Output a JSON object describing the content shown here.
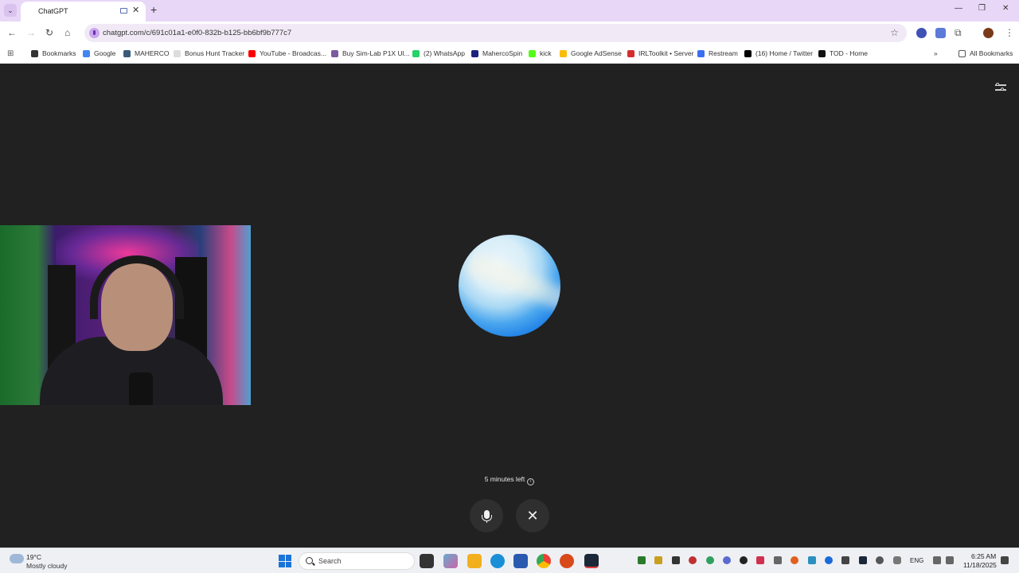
{
  "browser": {
    "tab": {
      "title": "ChatGPT"
    },
    "url": "chatgpt.com/c/691c01a1-e0f0-832b-b125-bb6bf9b777c7",
    "bookmarks": [
      {
        "label": "Bookmarks",
        "icon": "star-icon",
        "color": "#333333"
      },
      {
        "label": "Google",
        "icon": "google-icon",
        "color": "#4285f4"
      },
      {
        "label": "MAHERCO",
        "icon": "maherco-icon",
        "color": "#3a5a7a"
      },
      {
        "label": "Bonus Hunt Tracker",
        "icon": "page-icon",
        "color": "#dddddd"
      },
      {
        "label": "YouTube - Broadcas...",
        "icon": "youtube-icon",
        "color": "#ff0000"
      },
      {
        "label": "Buy Sim-Lab P1X Ul...",
        "icon": "simlab-icon",
        "color": "#7a5aa0"
      },
      {
        "label": "(2) WhatsApp",
        "icon": "whatsapp-icon",
        "color": "#25d366"
      },
      {
        "label": "MahercoSpin",
        "icon": "mahercospin-icon",
        "color": "#1a237e"
      },
      {
        "label": "kick",
        "icon": "kick-icon",
        "color": "#53fc18"
      },
      {
        "label": "Google AdSense",
        "icon": "adsense-icon",
        "color": "#fbbc04"
      },
      {
        "label": "IRLToolkit • Server",
        "icon": "irltoolkit-icon",
        "color": "#d32f2f"
      },
      {
        "label": "Restream",
        "icon": "restream-icon",
        "color": "#3a6ff0"
      },
      {
        "label": "(16) Home / Twitter",
        "icon": "x-icon",
        "color": "#000000"
      },
      {
        "label": "TOD - Home",
        "icon": "tod-icon",
        "color": "#111111"
      }
    ],
    "all_bookmarks": "All Bookmarks"
  },
  "voice": {
    "time_left": "5 minutes left"
  },
  "taskbar": {
    "weather_temp": "19°C",
    "weather_desc": "Mostly cloudy",
    "search_label": "Search",
    "lang": "ENG",
    "clock_time": "6:25 AM",
    "clock_date": "11/18/2025"
  }
}
